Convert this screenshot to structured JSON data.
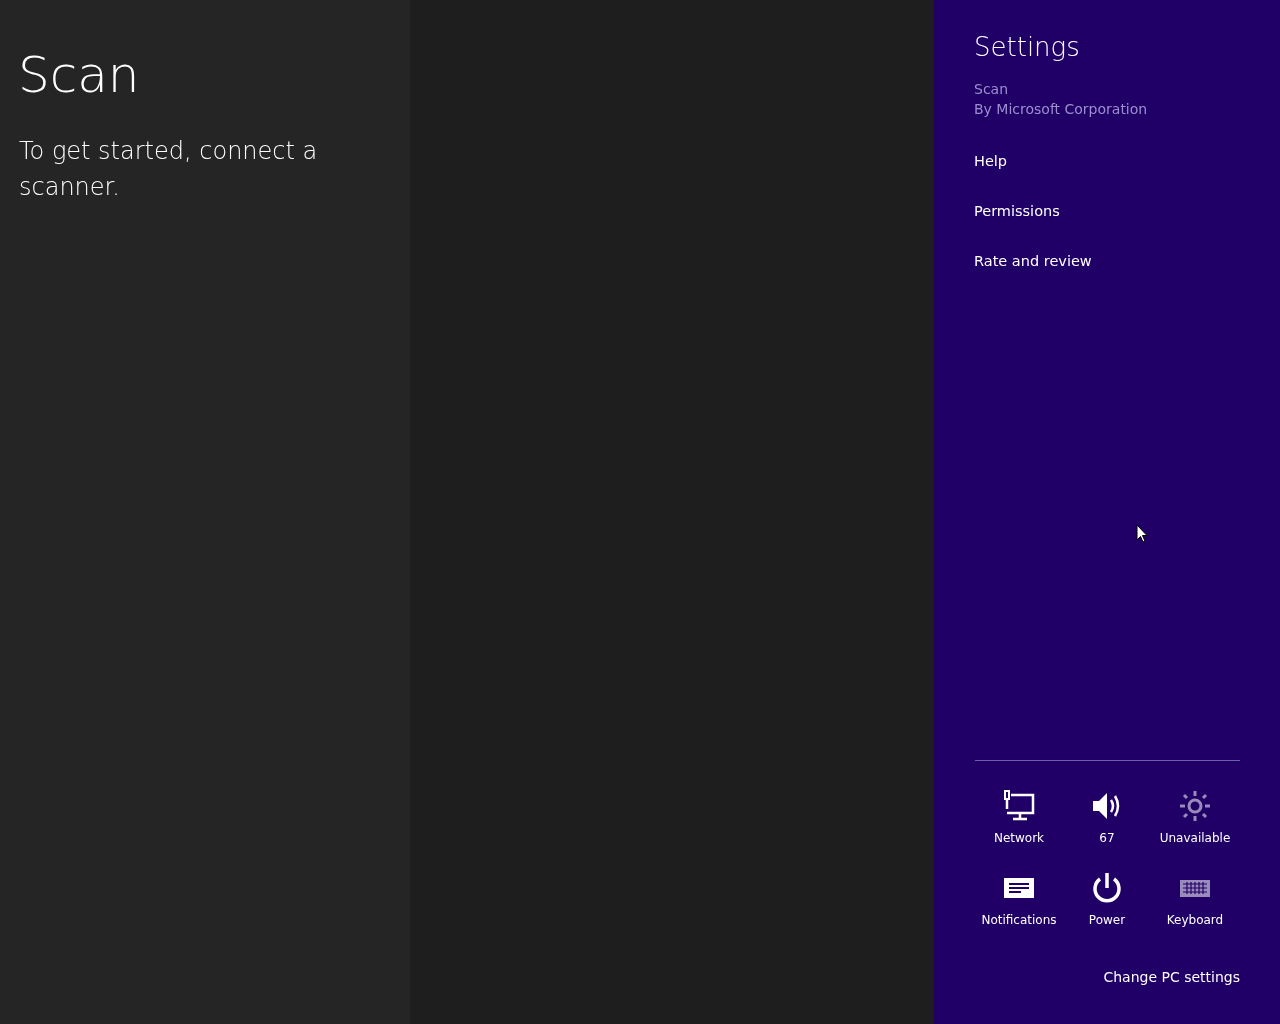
{
  "app": {
    "title": "Scan",
    "message": "To get started, connect a scanner."
  },
  "settings_pane": {
    "title": "Scan",
    "heading": "Settings",
    "publisher": "By Microsoft Corporation",
    "items": [
      {
        "label": "Help"
      },
      {
        "label": "Permissions"
      },
      {
        "label": "Rate and review"
      }
    ],
    "quick_settings": [
      {
        "kind": "network",
        "label": "Network",
        "disabled": false
      },
      {
        "kind": "volume",
        "label": "67",
        "disabled": false
      },
      {
        "kind": "brightness",
        "label": "Unavailable",
        "disabled": true
      },
      {
        "kind": "notifications",
        "label": "Notifications",
        "disabled": false
      },
      {
        "kind": "power",
        "label": "Power",
        "disabled": false
      },
      {
        "kind": "keyboard",
        "label": "Keyboard",
        "disabled": true
      }
    ],
    "footer_link": "Change PC settings"
  }
}
